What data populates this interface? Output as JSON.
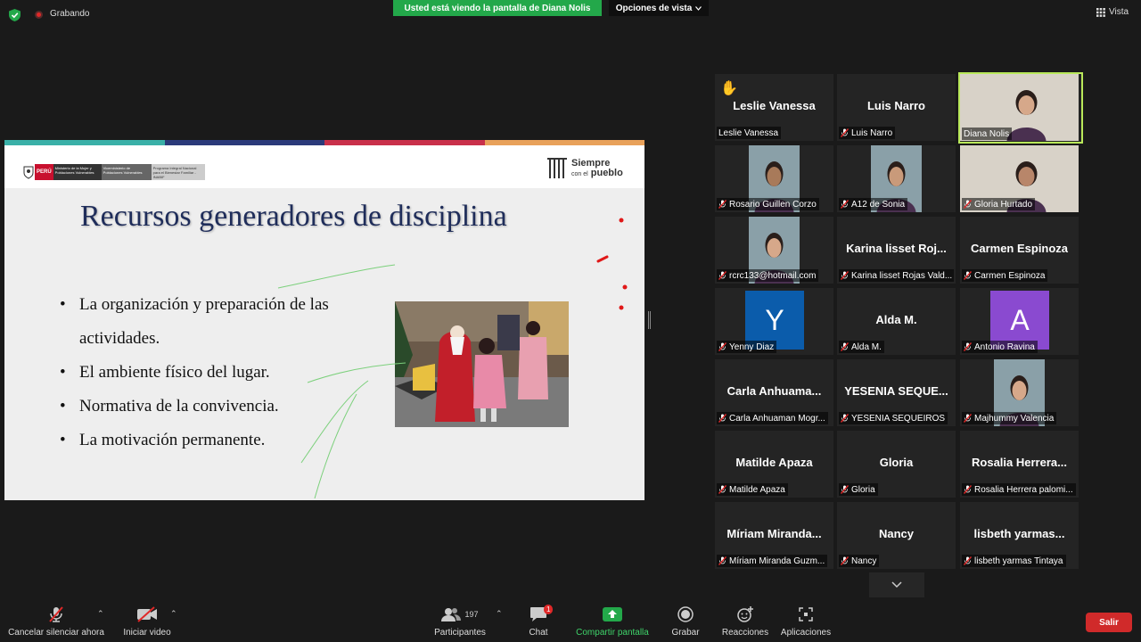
{
  "topbar": {
    "recording_label": "Grabando",
    "share_banner": "Usted está viendo la pantalla de Diana Nolis",
    "view_options": "Opciones de vista",
    "view_label": "Vista"
  },
  "slide": {
    "stripe_colors": [
      "#3ab0a8",
      "#2b3a7a",
      "#c9304a",
      "#e8a15a"
    ],
    "gov_logo": {
      "country": "PERÚ",
      "ministry": "Ministerio de la Mujer y Poblaciones Vulnerables",
      "vice_ministry": "Viceministerio de Poblaciones Vulnerables",
      "program": "Programa Integral Nacional para el Bienestar Familiar - INABIF"
    },
    "brand_title": "Siempre",
    "brand_subtitle_a": "con el",
    "brand_subtitle_b": "pueblo",
    "title": "Recursos generadores de disciplina",
    "bullets": [
      "La organización y preparación de las actividades.",
      "El ambiente físico del lugar.",
      "Normativa de la convivencia.",
      "La motivación permanente."
    ]
  },
  "participants": [
    {
      "big": "Leslie Vanessa",
      "label": "Leslie Vanessa",
      "muted": false,
      "hand": true,
      "type": "name"
    },
    {
      "big": "Luis Narro",
      "label": "Luis Narro",
      "muted": true,
      "type": "name"
    },
    {
      "big": "",
      "label": "Diana Nolis",
      "muted": false,
      "type": "video",
      "active": true
    },
    {
      "big": "",
      "label": "Rosario Guillen  Corzo",
      "muted": true,
      "type": "video"
    },
    {
      "big": "",
      "label": "A12 de Sonia",
      "muted": true,
      "type": "video"
    },
    {
      "big": "",
      "label": "Gloria Hurtado",
      "muted": true,
      "type": "video"
    },
    {
      "big": "",
      "label": "rcrc133@hotmail.com",
      "muted": true,
      "type": "video"
    },
    {
      "big": "Karina  lisset  Roj...",
      "label": "Karina lisset Rojas Vald...",
      "muted": true,
      "type": "name"
    },
    {
      "big": "Carmen  Espinoza",
      "label": "Carmen Espinoza",
      "muted": true,
      "type": "name"
    },
    {
      "big": "Y",
      "label": "Yenny Diaz",
      "muted": true,
      "type": "avatar",
      "color": "#0b5cab"
    },
    {
      "big": "Alda  M.",
      "label": "Alda M.",
      "muted": true,
      "type": "name"
    },
    {
      "big": "A",
      "label": "Antonio Ravina",
      "muted": true,
      "type": "avatar",
      "color": "#8a4ad0"
    },
    {
      "big": "Carla  Anhuama...",
      "label": "Carla Anhuaman Mogr...",
      "muted": true,
      "type": "name"
    },
    {
      "big": "YESENIA  SEQUE...",
      "label": "YESENIA SEQUEIROS",
      "muted": true,
      "type": "name"
    },
    {
      "big": "",
      "label": "Majhummy Valencia",
      "muted": true,
      "type": "video"
    },
    {
      "big": "Matilde  Apaza",
      "label": "Matilde Apaza",
      "muted": true,
      "type": "name"
    },
    {
      "big": "Gloria",
      "label": "Gloria",
      "muted": true,
      "type": "name"
    },
    {
      "big": "Rosalia  Herrera...",
      "label": "Rosalia Herrera palomi...",
      "muted": true,
      "type": "name"
    },
    {
      "big": "Míriam  Miranda...",
      "label": "Míriam Miranda Guzm...",
      "muted": true,
      "type": "name"
    },
    {
      "big": "Nancy",
      "label": "Nancy",
      "muted": true,
      "type": "name"
    },
    {
      "big": "lisbeth  yarmas...",
      "label": "lisbeth yarmas Tintaya",
      "muted": true,
      "type": "name"
    }
  ],
  "toolbar": {
    "unmute_label": "Cancelar silenciar ahora",
    "video_label": "Iniciar video",
    "participants_label": "Participantes",
    "participants_count": "197",
    "chat_label": "Chat",
    "chat_badge": "1",
    "share_label": "Compartir pantalla",
    "record_label": "Grabar",
    "reactions_label": "Reacciones",
    "apps_label": "Aplicaciones",
    "leave_label": "Salir"
  }
}
